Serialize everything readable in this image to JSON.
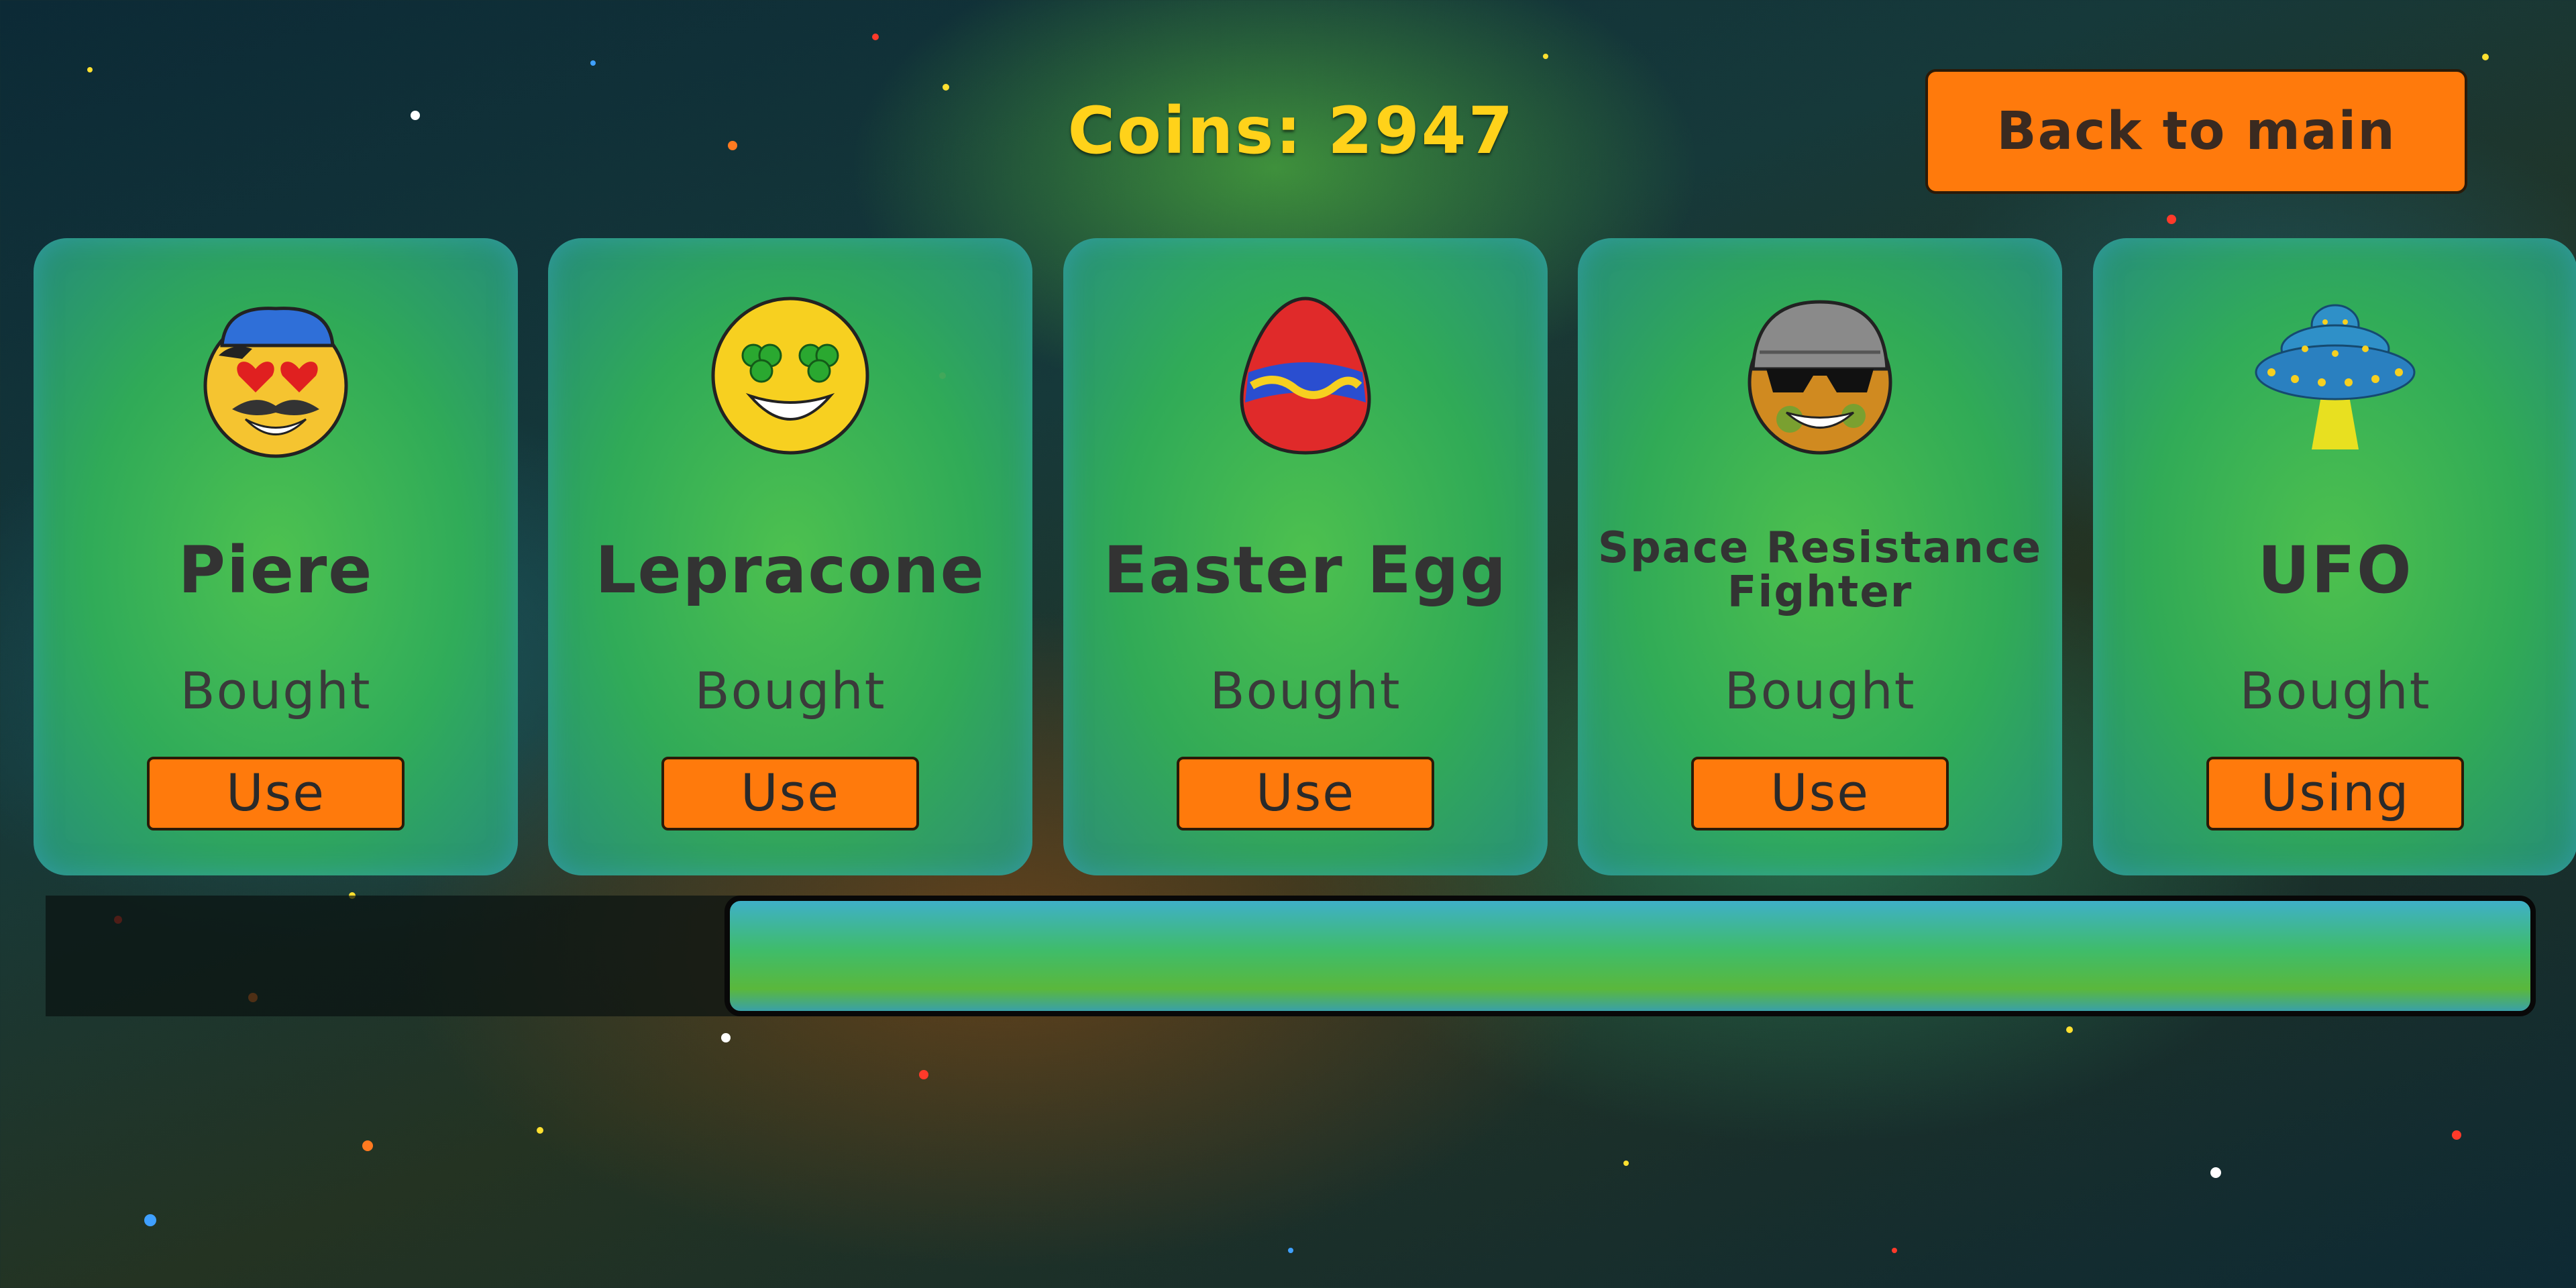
{
  "header": {
    "coins_label": "Coins: 2947",
    "back_button_label": "Back to main"
  },
  "colors": {
    "accent_orange": "#ff7a0c",
    "coin_yellow": "#ffd21a",
    "card_green": "#50c850"
  },
  "skins": [
    {
      "name": "Piere",
      "icon": "mustache-face-icon",
      "status": "Bought",
      "action": "Use"
    },
    {
      "name": "Lepracone",
      "icon": "shamrock-face-icon",
      "status": "Bought",
      "action": "Use"
    },
    {
      "name": "Easter Egg",
      "icon": "easter-egg-icon",
      "status": "Bought",
      "action": "Use"
    },
    {
      "name": "Space Resistance Fighter",
      "icon": "fighter-face-icon",
      "status": "Bought",
      "action": "Use"
    },
    {
      "name": "UFO",
      "icon": "ufo-icon",
      "status": "Bought",
      "action": "Using"
    }
  ]
}
